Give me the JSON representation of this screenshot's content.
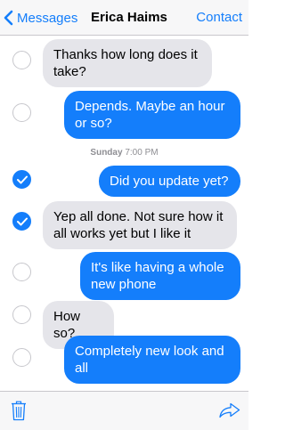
{
  "nav": {
    "back_label": "Messages",
    "title": "Erica Haims",
    "contact_label": "Contact"
  },
  "timestamp": {
    "day": "Sunday",
    "time": "7:00 PM"
  },
  "messages": [
    {
      "direction": "in",
      "text": "Thanks how long does it take?",
      "selected": false
    },
    {
      "direction": "out",
      "text": "Depends. Maybe an hour or so?",
      "selected": false
    },
    {
      "direction": "out",
      "text": "Did you update yet?",
      "selected": true
    },
    {
      "direction": "in",
      "text": "Yep all done. Not sure how it all works yet but I like it",
      "selected": true
    },
    {
      "direction": "out",
      "text": "It's like having a whole new phone",
      "selected": false
    },
    {
      "direction": "in",
      "text": "How so?",
      "selected": false
    },
    {
      "direction": "out",
      "text": "Completely new look and all",
      "selected": false
    }
  ],
  "toolbar": {
    "trash_icon": "trash-icon",
    "share_icon": "share-arrow-icon"
  },
  "colors": {
    "accent": "#147efb",
    "incoming_bubble": "#e5e5ea",
    "bar_background": "#f7f7f8"
  }
}
